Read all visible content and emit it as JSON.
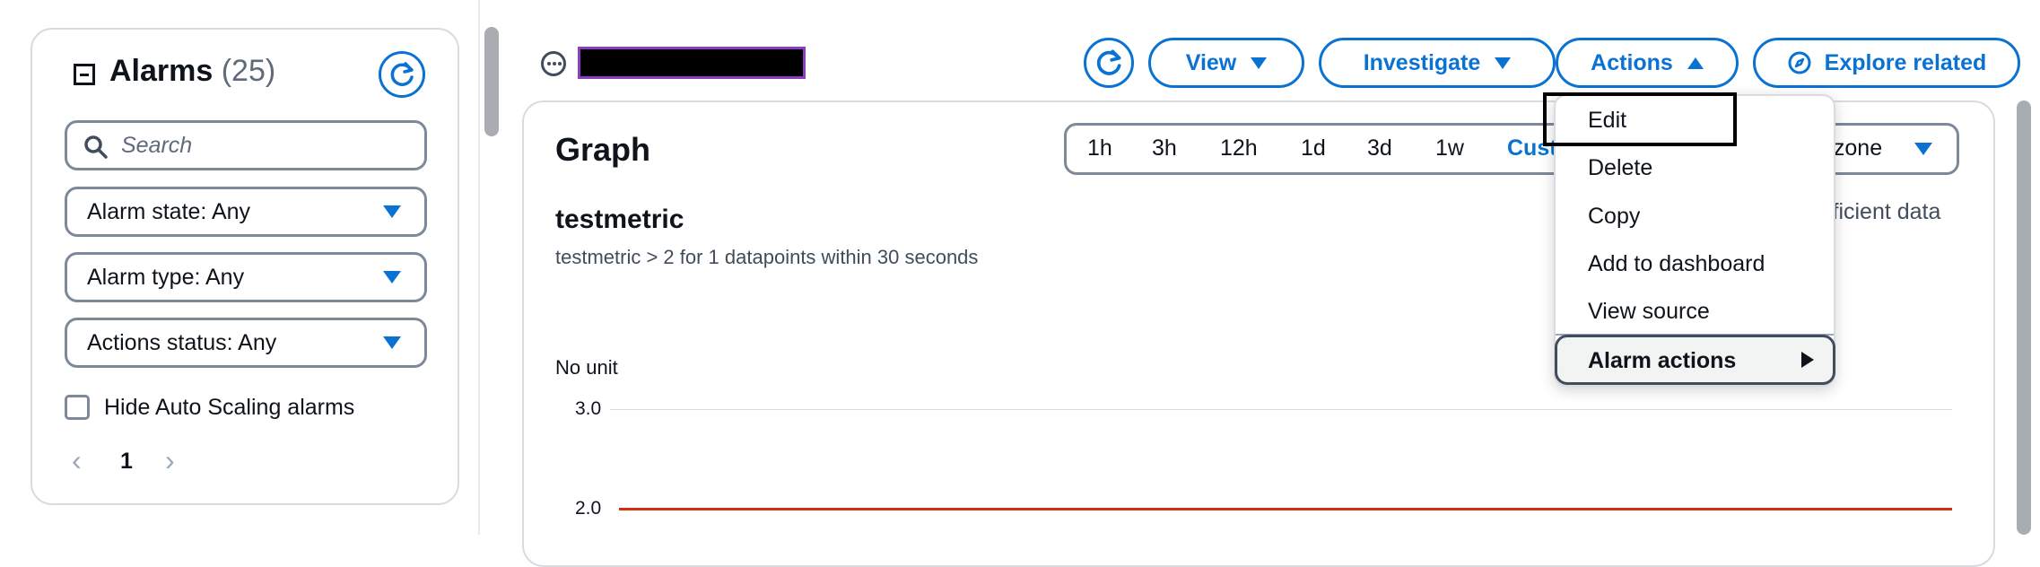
{
  "sidebar": {
    "title": "Alarms",
    "count": "(25)",
    "search_placeholder": "Search",
    "filters": [
      "Alarm state: Any",
      "Alarm type: Any",
      "Actions status: Any"
    ],
    "hide_autoscaling_label": "Hide Auto Scaling alarms",
    "page_number": "1"
  },
  "header": {
    "buttons": {
      "view": "View",
      "investigate": "Investigate",
      "actions": "Actions",
      "explore": "Explore related"
    }
  },
  "graph": {
    "title": "Graph",
    "ranges": [
      "1h",
      "3h",
      "12h",
      "1d",
      "3d",
      "1w"
    ],
    "custom_label": "Cust",
    "timezone_label": "ezone",
    "metric_name": "testmetric",
    "metric_description": "testmetric > 2 for 1 datapoints within 30 seconds",
    "status_text": "fficient data",
    "unit_label": "No unit",
    "y_ticks": [
      "3.0",
      "2.0"
    ],
    "threshold_value": 2,
    "threshold_color": "#d13212"
  },
  "actions_menu": {
    "items": [
      "Edit",
      "Delete",
      "Copy",
      "Add to dashboard",
      "View source"
    ],
    "submenu_label": "Alarm actions"
  },
  "colors": {
    "accent": "#0972d3",
    "redaction_border": "#8b3fbf"
  }
}
